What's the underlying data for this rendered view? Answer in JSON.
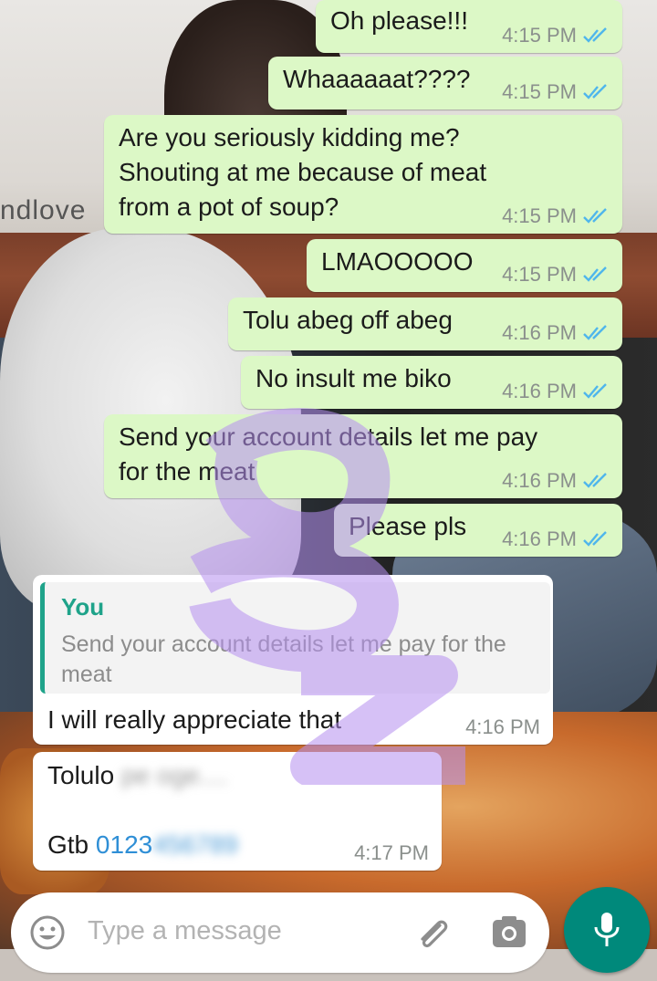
{
  "wallpaper": {
    "text": "ndlove"
  },
  "messages": [
    {
      "text": "Oh please!!!",
      "time": "4:15 PM",
      "status": "read"
    },
    {
      "text": "Whaaaaaat????",
      "time": "4:15 PM",
      "status": "read"
    },
    {
      "text": "Are you seriously kidding me?\nShouting at me because of meat\nfrom a pot of soup?",
      "time": "4:15 PM",
      "status": "read"
    },
    {
      "text": "LMAOOOOO",
      "time": "4:15 PM",
      "status": "read"
    },
    {
      "text": "Tolu abeg off abeg",
      "time": "4:16 PM",
      "status": "read"
    },
    {
      "text": "No insult me biko",
      "time": "4:16 PM",
      "status": "read"
    },
    {
      "text": "Send your account details let me pay\nfor the meat",
      "time": "4:16 PM",
      "status": "read"
    },
    {
      "text": "Please pls",
      "time": "4:16 PM",
      "status": "read"
    }
  ],
  "reply": {
    "quote_author": "You",
    "quote_text": "Send your account details let me pay for the meat",
    "text": "I will really appreciate that",
    "time": "4:16 PM"
  },
  "account_message": {
    "name_visible": "Tolulo",
    "bank": "Gtb",
    "account_visible": "0123",
    "time": "4:17 PM"
  },
  "input": {
    "placeholder": "Type a message"
  },
  "icons": {
    "emoji": "emoji-icon",
    "attach": "paperclip-icon",
    "camera": "camera-icon",
    "mic": "mic-icon",
    "read_receipt": "double-check-icon"
  },
  "colors": {
    "outgoing_bubble": "#dcf8c6",
    "incoming_bubble": "#ffffff",
    "quote_accent": "#1fa38a",
    "read_ticks": "#4fb6ec",
    "mic_button": "#00897b"
  }
}
